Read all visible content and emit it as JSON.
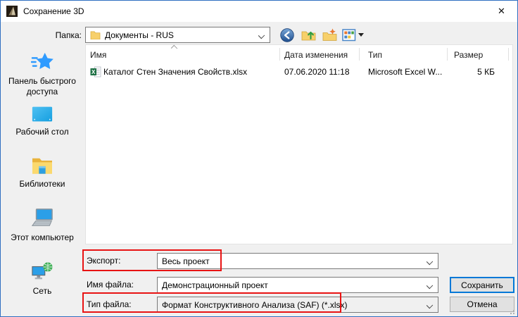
{
  "window": {
    "title": "Сохранение 3D",
    "close_glyph": "✕"
  },
  "toolbar": {
    "folder_label": "Папка:",
    "folder_value": "Документы - RUS"
  },
  "sidebar": {
    "items": [
      {
        "label": "Панель быстрого доступа",
        "icon": "quick-access-star-icon"
      },
      {
        "label": "Рабочий стол",
        "icon": "desktop-icon"
      },
      {
        "label": "Библиотеки",
        "icon": "libraries-folder-icon"
      },
      {
        "label": "Этот компьютер",
        "icon": "this-pc-icon"
      },
      {
        "label": "Сеть",
        "icon": "network-icon"
      }
    ]
  },
  "file_list": {
    "columns": [
      "Имя",
      "Дата изменения",
      "Тип",
      "Размер"
    ],
    "sort": "name-ascending",
    "rows": [
      {
        "name": "Каталог Стен Значения Свойств.xlsx",
        "date": "07.06.2020 11:18",
        "type": "Microsoft Excel W...",
        "size": "5 КБ",
        "icon": "excel-file-icon"
      }
    ]
  },
  "form": {
    "export_label": "Экспорт:",
    "export_value": "Весь проект",
    "filename_label": "Имя файла:",
    "filename_value": "Демонстрационный проект",
    "filetype_label": "Тип файла:",
    "filetype_value": "Формат Конструктивного Анализа (SAF) (*.xlsx)"
  },
  "buttons": {
    "save": "Сохранить",
    "cancel": "Отмена"
  },
  "icons": {
    "titlebar": "app-logo-icon",
    "toolbar": [
      "back-icon",
      "folder-up-icon",
      "new-folder-icon",
      "views-icon"
    ],
    "combo": "chevron-down-icon",
    "header_sort": "sort-ascending-icon"
  },
  "colors": {
    "accent_blue": "#0078d7",
    "annotation_red": "#e81313",
    "window_bg": "#f0f0f0",
    "button_bg": "#e1e1e1",
    "disabled_field_bg": "#f0f0f0"
  }
}
